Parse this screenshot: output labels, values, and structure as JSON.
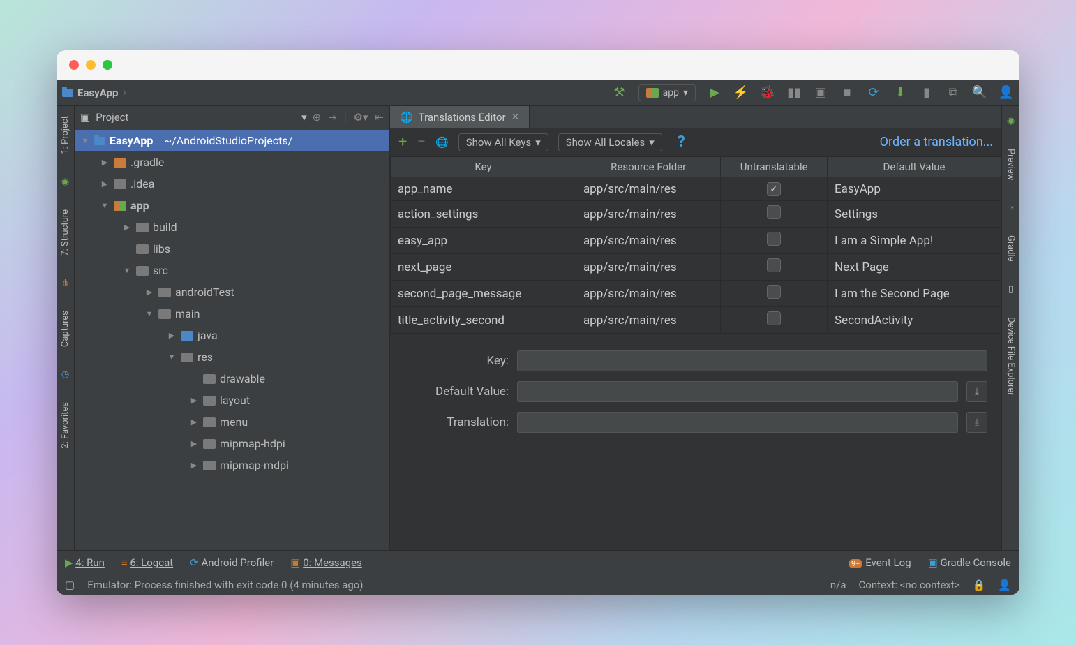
{
  "breadcrumb": {
    "project": "EasyApp"
  },
  "runConfig": "app",
  "projectDropdown": "Project",
  "tree": {
    "root": {
      "name": "EasyApp",
      "path": "~/AndroidStudioProjects/"
    },
    "gradle": ".gradle",
    "idea": ".idea",
    "app": "app",
    "build": "build",
    "libs": "libs",
    "src": "src",
    "androidTest": "androidTest",
    "main": "main",
    "java": "java",
    "res": "res",
    "drawable": "drawable",
    "layout": "layout",
    "menu": "menu",
    "mipmap_hdpi": "mipmap-hdpi",
    "mipmap_mdpi": "mipmap-mdpi"
  },
  "tab": {
    "title": "Translations Editor"
  },
  "filters": {
    "keys": "Show All Keys",
    "locales": "Show All Locales"
  },
  "orderLink": "Order a translation...",
  "columns": {
    "key": "Key",
    "folder": "Resource Folder",
    "untrans": "Untranslatable",
    "default": "Default Value"
  },
  "rows": [
    {
      "key": "app_name",
      "folder": "app/src/main/res",
      "untrans": true,
      "default": "EasyApp"
    },
    {
      "key": "action_settings",
      "folder": "app/src/main/res",
      "untrans": false,
      "default": "Settings"
    },
    {
      "key": "easy_app",
      "folder": "app/src/main/res",
      "untrans": false,
      "default": "I am a Simple App!"
    },
    {
      "key": "next_page",
      "folder": "app/src/main/res",
      "untrans": false,
      "default": "Next Page"
    },
    {
      "key": "second_page_message",
      "folder": "app/src/main/res",
      "untrans": false,
      "default": "I am the Second Page"
    },
    {
      "key": "title_activity_second",
      "folder": "app/src/main/res",
      "untrans": false,
      "default": "SecondActivity"
    }
  ],
  "detail": {
    "key_label": "Key:",
    "default_label": "Default Value:",
    "translation_label": "Translation:"
  },
  "leftbar": {
    "project": "1: Project",
    "structure": "7: Structure",
    "captures": "Captures",
    "favorites": "2: Favorites"
  },
  "rightbar": {
    "preview": "Preview",
    "gradle": "Gradle",
    "device": "Device File Explorer"
  },
  "bottom": {
    "run": "4: Run",
    "logcat": "6: Logcat",
    "profiler": "Android Profiler",
    "messages": "0: Messages",
    "eventlog": "Event Log",
    "gradleConsole": "Gradle Console"
  },
  "status": {
    "message": "Emulator: Process finished with exit code 0 (4 minutes ago)",
    "na": "n/a",
    "context": "Context: <no context>"
  }
}
